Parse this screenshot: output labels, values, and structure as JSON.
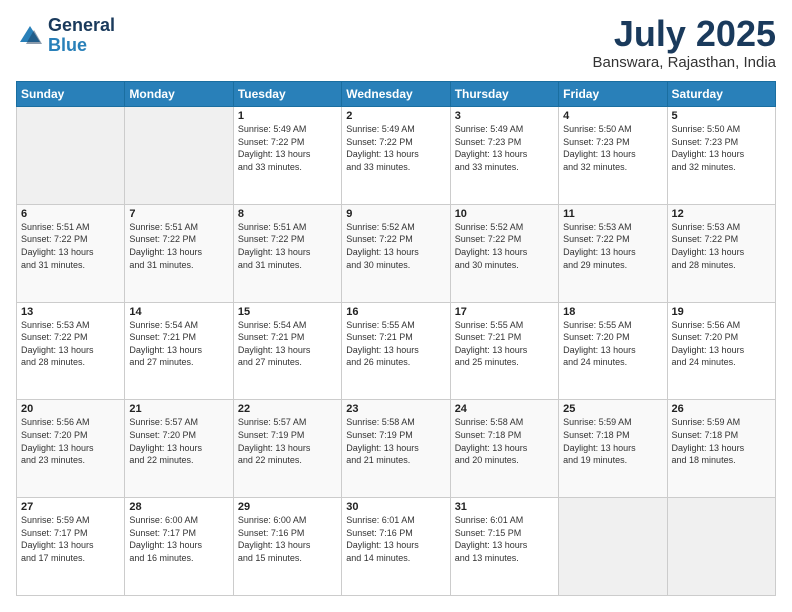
{
  "logo": {
    "line1": "General",
    "line2": "Blue"
  },
  "header": {
    "title": "July 2025",
    "subtitle": "Banswara, Rajasthan, India"
  },
  "days_of_week": [
    "Sunday",
    "Monday",
    "Tuesday",
    "Wednesday",
    "Thursday",
    "Friday",
    "Saturday"
  ],
  "weeks": [
    [
      {
        "day": "",
        "info": ""
      },
      {
        "day": "",
        "info": ""
      },
      {
        "day": "1",
        "info": "Sunrise: 5:49 AM\nSunset: 7:22 PM\nDaylight: 13 hours\nand 33 minutes."
      },
      {
        "day": "2",
        "info": "Sunrise: 5:49 AM\nSunset: 7:22 PM\nDaylight: 13 hours\nand 33 minutes."
      },
      {
        "day": "3",
        "info": "Sunrise: 5:49 AM\nSunset: 7:23 PM\nDaylight: 13 hours\nand 33 minutes."
      },
      {
        "day": "4",
        "info": "Sunrise: 5:50 AM\nSunset: 7:23 PM\nDaylight: 13 hours\nand 32 minutes."
      },
      {
        "day": "5",
        "info": "Sunrise: 5:50 AM\nSunset: 7:23 PM\nDaylight: 13 hours\nand 32 minutes."
      }
    ],
    [
      {
        "day": "6",
        "info": "Sunrise: 5:51 AM\nSunset: 7:22 PM\nDaylight: 13 hours\nand 31 minutes."
      },
      {
        "day": "7",
        "info": "Sunrise: 5:51 AM\nSunset: 7:22 PM\nDaylight: 13 hours\nand 31 minutes."
      },
      {
        "day": "8",
        "info": "Sunrise: 5:51 AM\nSunset: 7:22 PM\nDaylight: 13 hours\nand 31 minutes."
      },
      {
        "day": "9",
        "info": "Sunrise: 5:52 AM\nSunset: 7:22 PM\nDaylight: 13 hours\nand 30 minutes."
      },
      {
        "day": "10",
        "info": "Sunrise: 5:52 AM\nSunset: 7:22 PM\nDaylight: 13 hours\nand 30 minutes."
      },
      {
        "day": "11",
        "info": "Sunrise: 5:53 AM\nSunset: 7:22 PM\nDaylight: 13 hours\nand 29 minutes."
      },
      {
        "day": "12",
        "info": "Sunrise: 5:53 AM\nSunset: 7:22 PM\nDaylight: 13 hours\nand 28 minutes."
      }
    ],
    [
      {
        "day": "13",
        "info": "Sunrise: 5:53 AM\nSunset: 7:22 PM\nDaylight: 13 hours\nand 28 minutes."
      },
      {
        "day": "14",
        "info": "Sunrise: 5:54 AM\nSunset: 7:21 PM\nDaylight: 13 hours\nand 27 minutes."
      },
      {
        "day": "15",
        "info": "Sunrise: 5:54 AM\nSunset: 7:21 PM\nDaylight: 13 hours\nand 27 minutes."
      },
      {
        "day": "16",
        "info": "Sunrise: 5:55 AM\nSunset: 7:21 PM\nDaylight: 13 hours\nand 26 minutes."
      },
      {
        "day": "17",
        "info": "Sunrise: 5:55 AM\nSunset: 7:21 PM\nDaylight: 13 hours\nand 25 minutes."
      },
      {
        "day": "18",
        "info": "Sunrise: 5:55 AM\nSunset: 7:20 PM\nDaylight: 13 hours\nand 24 minutes."
      },
      {
        "day": "19",
        "info": "Sunrise: 5:56 AM\nSunset: 7:20 PM\nDaylight: 13 hours\nand 24 minutes."
      }
    ],
    [
      {
        "day": "20",
        "info": "Sunrise: 5:56 AM\nSunset: 7:20 PM\nDaylight: 13 hours\nand 23 minutes."
      },
      {
        "day": "21",
        "info": "Sunrise: 5:57 AM\nSunset: 7:20 PM\nDaylight: 13 hours\nand 22 minutes."
      },
      {
        "day": "22",
        "info": "Sunrise: 5:57 AM\nSunset: 7:19 PM\nDaylight: 13 hours\nand 22 minutes."
      },
      {
        "day": "23",
        "info": "Sunrise: 5:58 AM\nSunset: 7:19 PM\nDaylight: 13 hours\nand 21 minutes."
      },
      {
        "day": "24",
        "info": "Sunrise: 5:58 AM\nSunset: 7:18 PM\nDaylight: 13 hours\nand 20 minutes."
      },
      {
        "day": "25",
        "info": "Sunrise: 5:59 AM\nSunset: 7:18 PM\nDaylight: 13 hours\nand 19 minutes."
      },
      {
        "day": "26",
        "info": "Sunrise: 5:59 AM\nSunset: 7:18 PM\nDaylight: 13 hours\nand 18 minutes."
      }
    ],
    [
      {
        "day": "27",
        "info": "Sunrise: 5:59 AM\nSunset: 7:17 PM\nDaylight: 13 hours\nand 17 minutes."
      },
      {
        "day": "28",
        "info": "Sunrise: 6:00 AM\nSunset: 7:17 PM\nDaylight: 13 hours\nand 16 minutes."
      },
      {
        "day": "29",
        "info": "Sunrise: 6:00 AM\nSunset: 7:16 PM\nDaylight: 13 hours\nand 15 minutes."
      },
      {
        "day": "30",
        "info": "Sunrise: 6:01 AM\nSunset: 7:16 PM\nDaylight: 13 hours\nand 14 minutes."
      },
      {
        "day": "31",
        "info": "Sunrise: 6:01 AM\nSunset: 7:15 PM\nDaylight: 13 hours\nand 13 minutes."
      },
      {
        "day": "",
        "info": ""
      },
      {
        "day": "",
        "info": ""
      }
    ]
  ]
}
